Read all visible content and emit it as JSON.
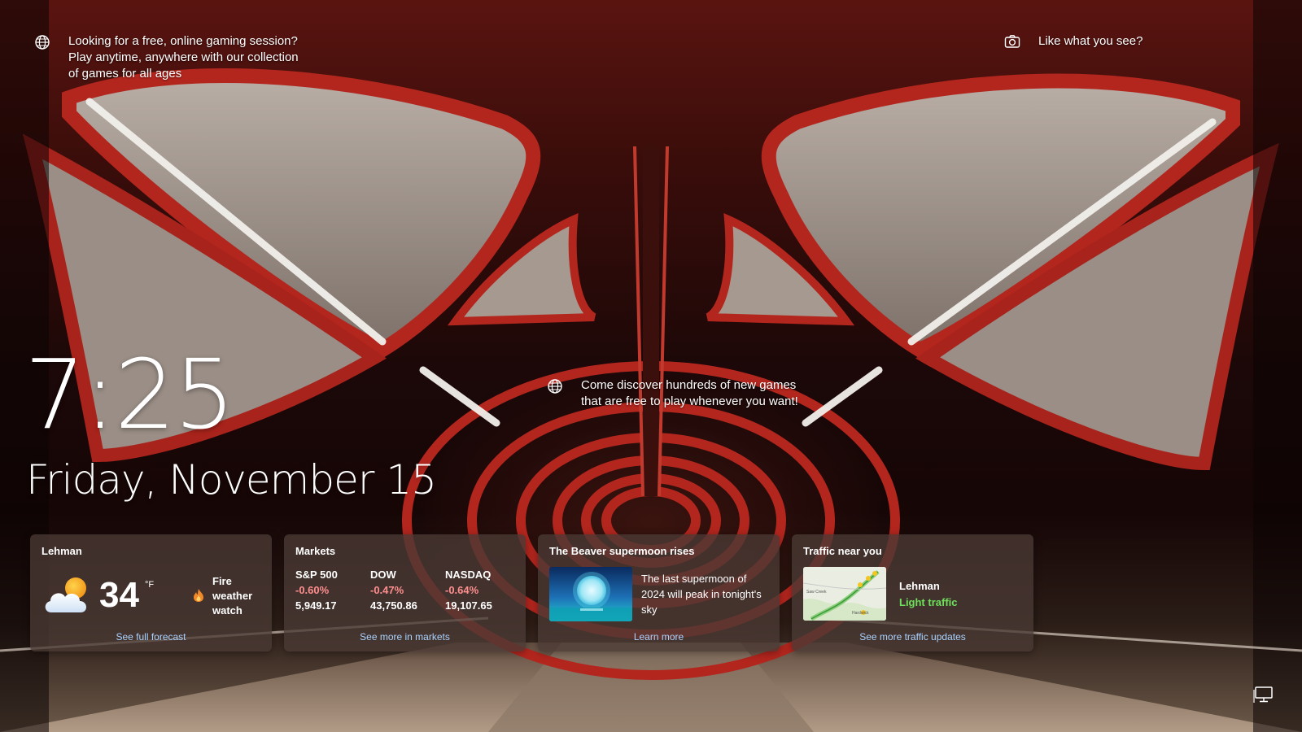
{
  "spotlight": {
    "top_tip": "Looking for a free, online gaming session? Play anytime, anywhere with our collection of games for all ages",
    "center_tip": "Come discover hundreds of new games that are free to play whenever you want!",
    "like_text": "Like what you see?"
  },
  "clock": {
    "time": "7:25",
    "date": "Friday, November 15"
  },
  "widgets": {
    "weather": {
      "title": "Lehman",
      "temperature": "34",
      "unit": "°F",
      "alert": "Fire weather watch",
      "icon": "partly-cloudy-icon",
      "link": "See full forecast"
    },
    "markets": {
      "title": "Markets",
      "items": [
        {
          "name": "S&P 500",
          "change": "-0.60%",
          "value": "5,949.17"
        },
        {
          "name": "DOW",
          "change": "-0.47%",
          "value": "43,750.86"
        },
        {
          "name": "NASDAQ",
          "change": "-0.64%",
          "value": "19,107.65"
        }
      ],
      "negative_color": "#ff8f8f",
      "link": "See more in markets"
    },
    "news": {
      "title": "The Beaver supermoon rises",
      "text": "The last supermoon of 2024 will peak in tonight's sky",
      "link": "Learn more"
    },
    "traffic": {
      "title": "Traffic near you",
      "location": "Lehman",
      "status": "Light traffic",
      "status_color": "#6ee05c",
      "map_labels": [
        "Saw Creek",
        "Hardwick"
      ],
      "link": "See more traffic updates"
    }
  },
  "icons": {
    "globe": "globe-icon",
    "camera": "camera-icon",
    "network": "network-icon",
    "fire": "fire-icon"
  }
}
